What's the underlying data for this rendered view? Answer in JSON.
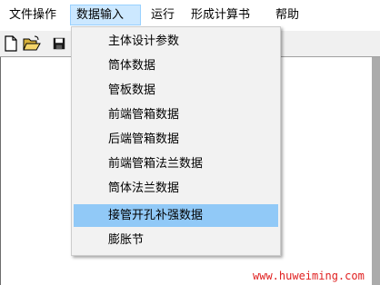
{
  "menubar": {
    "items": [
      {
        "label": "文件操作"
      },
      {
        "label": "数据输入"
      },
      {
        "label": "运行"
      },
      {
        "label": "形成计算书"
      },
      {
        "label": "帮助"
      }
    ]
  },
  "toolbar": {
    "buttons": [
      {
        "icon": "new-document-icon"
      },
      {
        "icon": "open-folder-icon"
      },
      {
        "icon": "save-disk-icon"
      }
    ]
  },
  "dropdown": {
    "items": [
      {
        "label": "主体设计参数"
      },
      {
        "label": "筒体数据"
      },
      {
        "label": "管板数据"
      },
      {
        "label": "前端管箱数据"
      },
      {
        "label": "后端管箱数据"
      },
      {
        "label": "前端管箱法兰数据"
      },
      {
        "label": "筒体法兰数据"
      },
      {
        "label": "接管开孔补强数据"
      },
      {
        "label": "膨胀节"
      }
    ],
    "highlighted": "接管开孔补强数据"
  },
  "watermark": {
    "text": "www.huweiming.com"
  },
  "colors": {
    "menu_active_bg": "#cce8ff",
    "item_highlight": "#91c9f7",
    "watermark": "#e02020"
  }
}
